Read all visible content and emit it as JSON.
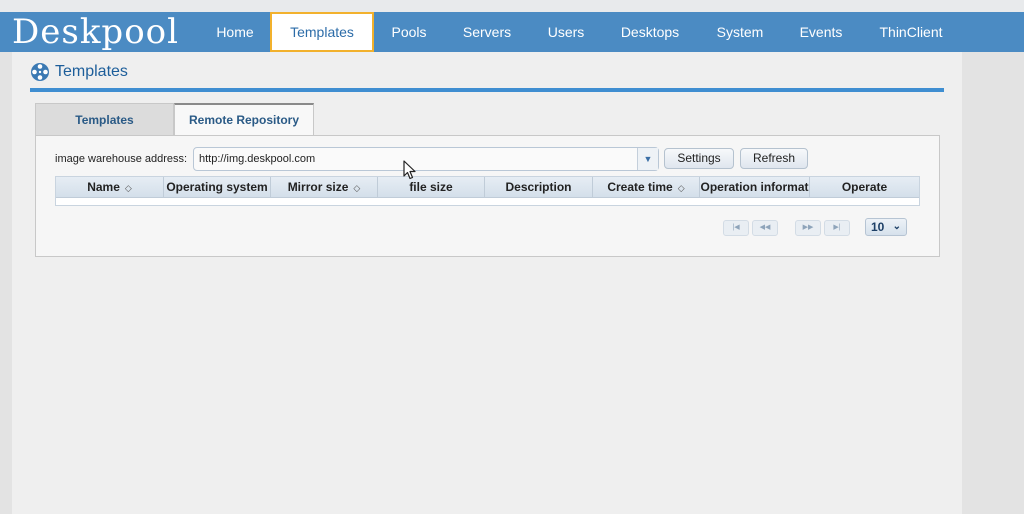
{
  "app": {
    "logo": "Deskpool"
  },
  "nav": {
    "items": [
      {
        "label": "Home"
      },
      {
        "label": "Templates"
      },
      {
        "label": "Pools"
      },
      {
        "label": "Servers"
      },
      {
        "label": "Users"
      },
      {
        "label": "Desktops"
      },
      {
        "label": "System"
      },
      {
        "label": "Events"
      },
      {
        "label": "ThinClient"
      }
    ],
    "active": "Templates"
  },
  "page": {
    "title": "Templates",
    "title_icon": "film-reel-icon"
  },
  "tabs": [
    {
      "label": "Templates",
      "active": false
    },
    {
      "label": "Remote Repository",
      "active": true
    }
  ],
  "repository": {
    "address_label": "image warehouse address:",
    "address_value": "http://img.deskpool.com",
    "settings_label": "Settings",
    "refresh_label": "Refresh"
  },
  "table": {
    "columns": [
      {
        "label": "Name",
        "sortable": true
      },
      {
        "label": "Operating system",
        "sortable": false
      },
      {
        "label": "Mirror size",
        "sortable": true
      },
      {
        "label": "file size",
        "sortable": false
      },
      {
        "label": "Description",
        "sortable": false
      },
      {
        "label": "Create time",
        "sortable": true
      },
      {
        "label": "Operation informat",
        "sortable": false
      },
      {
        "label": "Operate",
        "sortable": false
      }
    ],
    "rows": []
  },
  "pagination": {
    "page_size": "10",
    "buttons": [
      "first",
      "prev",
      "next",
      "last"
    ]
  },
  "colors": {
    "nav_bg": "#4b8bc3",
    "accent": "#3f8ed1",
    "active_nav_border": "#f2b12d"
  }
}
